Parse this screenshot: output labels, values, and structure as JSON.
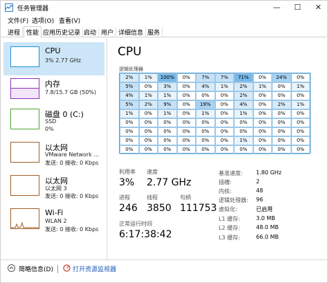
{
  "window": {
    "title": "任务管理器",
    "min": "—",
    "max": "☐",
    "close": "✕"
  },
  "menu": [
    "文件(F)",
    "选项(O)",
    "查看(V)"
  ],
  "tabs": [
    "进程",
    "性能",
    "应用历史记录",
    "启动",
    "用户",
    "详细信息",
    "服务"
  ],
  "active_tab_index": 1,
  "sidebar": [
    {
      "title": "CPU",
      "lines": [
        "3% 2.77 GHz"
      ],
      "color": "#1c8ed6",
      "selected": true
    },
    {
      "title": "内存",
      "lines": [
        "7.8/15.7 GB (50%)"
      ],
      "color": "#8b2fb8",
      "selected": false
    },
    {
      "title": "磁盘 0 (C:)",
      "lines": [
        "SSD",
        "0%"
      ],
      "color": "#4ca42f",
      "selected": false
    },
    {
      "title": "以太网",
      "lines": [
        "VMware Network ...",
        "发送: 0 接收: 0 Kbps"
      ],
      "color": "#a15d23",
      "selected": false
    },
    {
      "title": "以太网",
      "lines": [
        "以太网 3",
        "发送: 0 接收: 0 Kbps"
      ],
      "color": "#a15d23",
      "selected": false
    },
    {
      "title": "Wi-Fi",
      "lines": [
        "WLAN 2",
        "发送: 0 接收: 0 Kbps"
      ],
      "color": "#a15d23",
      "selected": false
    }
  ],
  "cpu": {
    "title": "CPU",
    "grid_label": "逻辑处理器",
    "cores": [
      "2%",
      "1%",
      "100%",
      "0%",
      "7%",
      "7%",
      "71%",
      "0%",
      "24%",
      "0%",
      "5%",
      "0%",
      "3%",
      "0%",
      "4%",
      "1%",
      "2%",
      "1%",
      "0%",
      "1%",
      "4%",
      "1%",
      "1%",
      "0%",
      "0%",
      "0%",
      "2%",
      "0%",
      "0%",
      "0%",
      "5%",
      "2%",
      "9%",
      "0%",
      "19%",
      "0%",
      "4%",
      "0%",
      "2%",
      "1%",
      "1%",
      "0%",
      "1%",
      "0%",
      "1%",
      "0%",
      "1%",
      "0%",
      "0%",
      "0%",
      "0%",
      "0%",
      "0%",
      "0%",
      "0%",
      "0%",
      "0%",
      "0%",
      "0%",
      "0%",
      "0%",
      "0%",
      "0%",
      "0%",
      "0%",
      "0%",
      "0%",
      "0%",
      "0%",
      "0%",
      "0%",
      "0%",
      "0%",
      "0%",
      "0%",
      "0%",
      "1%",
      "0%",
      "0%",
      "0%",
      "0%",
      "0%",
      "0%",
      "0%",
      "0%",
      "0%",
      "0%",
      "0%",
      "0%",
      "0%"
    ],
    "stats": {
      "util_label": "利用率",
      "util": "3%",
      "speed_label": "速度",
      "speed": "2.77 GHz",
      "proc_label": "进程",
      "proc": "246",
      "threads_label": "线程",
      "threads": "3850",
      "handles_label": "句柄",
      "handles": "111753",
      "uptime_label": "正常运行时间",
      "uptime": "6:17:38:42"
    },
    "specs": [
      {
        "k": "基准速度:",
        "v": "1.80 GHz"
      },
      {
        "k": "插槽:",
        "v": "2"
      },
      {
        "k": "内核:",
        "v": "48"
      },
      {
        "k": "逻辑处理器:",
        "v": "96"
      },
      {
        "k": "虚拟化:",
        "v": "已启用"
      },
      {
        "k": "L1 缓存:",
        "v": "3.0 MB"
      },
      {
        "k": "L2 缓存:",
        "v": "48.0 MB"
      },
      {
        "k": "L3 缓存:",
        "v": "66.0 MB"
      }
    ]
  },
  "footer": {
    "summary": "简略信息(D)",
    "monitor": "打开资源监视器"
  }
}
